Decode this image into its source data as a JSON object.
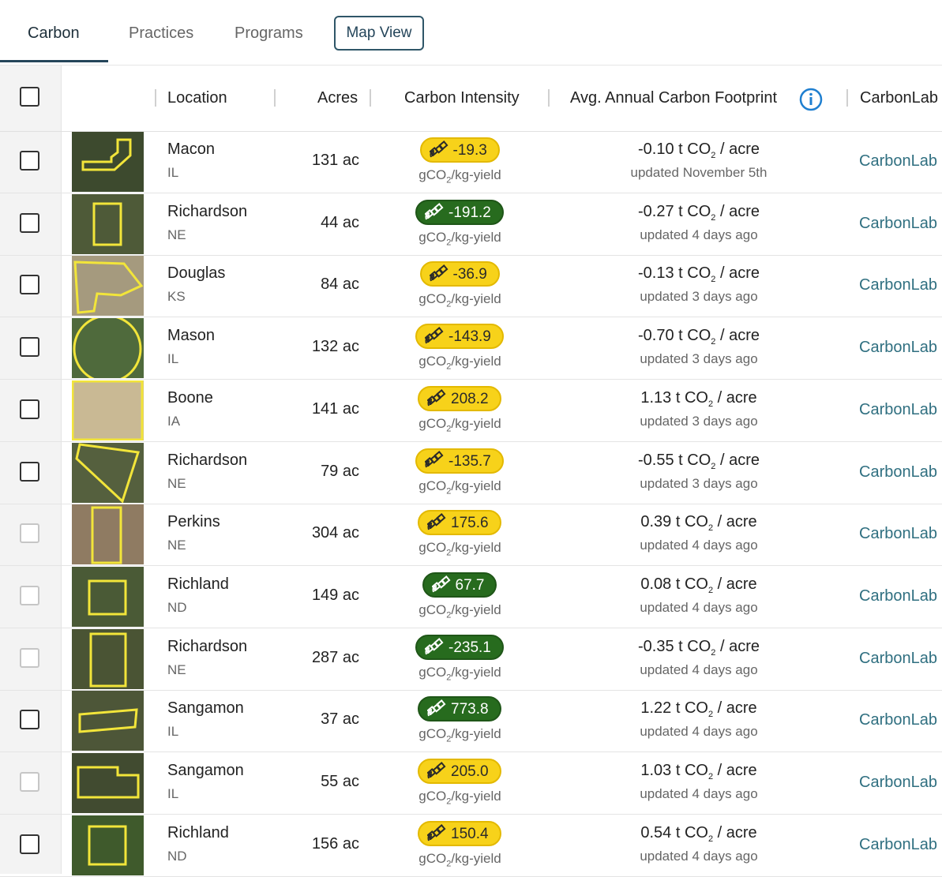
{
  "tabs": [
    "Carbon",
    "Practices",
    "Programs"
  ],
  "map_view_label": "Map View",
  "columns": {
    "location": "Location",
    "acres": "Acres",
    "carbon_intensity": "Carbon Intensity",
    "footprint": "Avg. Annual Carbon Footprint",
    "lab": "CarbonLab"
  },
  "ci_unit_a": "gCO",
  "ci_unit_b": "2",
  "ci_unit_c": "/kg-yield",
  "fp_unit_a": "t CO",
  "fp_unit_b": "2",
  "fp_unit_c": "/ acre",
  "colors": {
    "badge_yellow": "#f7d21a",
    "badge_green": "#276b1e",
    "field_outline": "#f2e53a",
    "accent": "#24455a"
  },
  "icons": {
    "sat_icon": "satellite-icon",
    "info_icon": "info-icon"
  },
  "rows": [
    {
      "name": "Macon",
      "state": "IL",
      "acres": "131 ac",
      "ci": "-19.3",
      "ci_color": "yellow",
      "fp": "-0.10",
      "updated": "updated November 5th",
      "lab": "CarbonLab",
      "checkbox": "dark"
    },
    {
      "name": "Richardson",
      "state": "NE",
      "acres": "44 ac",
      "ci": "-191.2",
      "ci_color": "green",
      "fp": "-0.27",
      "updated": "updated 4 days ago",
      "lab": "CarbonLab",
      "checkbox": "dark"
    },
    {
      "name": "Douglas",
      "state": "KS",
      "acres": "84 ac",
      "ci": "-36.9",
      "ci_color": "yellow",
      "fp": "-0.13",
      "updated": "updated 3 days ago",
      "lab": "CarbonLab",
      "checkbox": "dark"
    },
    {
      "name": "Mason",
      "state": "IL",
      "acres": "132 ac",
      "ci": "-143.9",
      "ci_color": "yellow",
      "fp": "-0.70",
      "updated": "updated 3 days ago",
      "lab": "CarbonLab",
      "checkbox": "dark"
    },
    {
      "name": "Boone",
      "state": "IA",
      "acres": "141 ac",
      "ci": "208.2",
      "ci_color": "yellow",
      "fp": "1.13",
      "updated": "updated 3 days ago",
      "lab": "CarbonLab",
      "checkbox": "dark"
    },
    {
      "name": "Richardson",
      "state": "NE",
      "acres": "79 ac",
      "ci": "-135.7",
      "ci_color": "yellow",
      "fp": "-0.55",
      "updated": "updated 3 days ago",
      "lab": "CarbonLab",
      "checkbox": "dark"
    },
    {
      "name": "Perkins",
      "state": "NE",
      "acres": "304 ac",
      "ci": "175.6",
      "ci_color": "yellow",
      "fp": "0.39",
      "updated": "updated 4 days ago",
      "lab": "CarbonLab",
      "checkbox": "dim"
    },
    {
      "name": "Richland",
      "state": "ND",
      "acres": "149 ac",
      "ci": "67.7",
      "ci_color": "green",
      "fp": "0.08",
      "updated": "updated 4 days ago",
      "lab": "CarbonLab",
      "checkbox": "dim"
    },
    {
      "name": "Richardson",
      "state": "NE",
      "acres": "287 ac",
      "ci": "-235.1",
      "ci_color": "green",
      "fp": "-0.35",
      "updated": "updated 4 days ago",
      "lab": "CarbonLab",
      "checkbox": "dim"
    },
    {
      "name": "Sangamon",
      "state": "IL",
      "acres": "37 ac",
      "ci": "773.8",
      "ci_color": "green",
      "fp": "1.22",
      "updated": "updated 4 days ago",
      "lab": "CarbonLab",
      "checkbox": "dark"
    },
    {
      "name": "Sangamon",
      "state": "IL",
      "acres": "55 ac",
      "ci": "205.0",
      "ci_color": "yellow",
      "fp": "1.03",
      "updated": "updated 4 days ago",
      "lab": "CarbonLab",
      "checkbox": "dim"
    },
    {
      "name": "Richland",
      "state": "ND",
      "acres": "156 ac",
      "ci": "150.4",
      "ci_color": "yellow",
      "fp": "0.54",
      "updated": "updated 4 days ago",
      "lab": "CarbonLab",
      "checkbox": "dark"
    }
  ]
}
